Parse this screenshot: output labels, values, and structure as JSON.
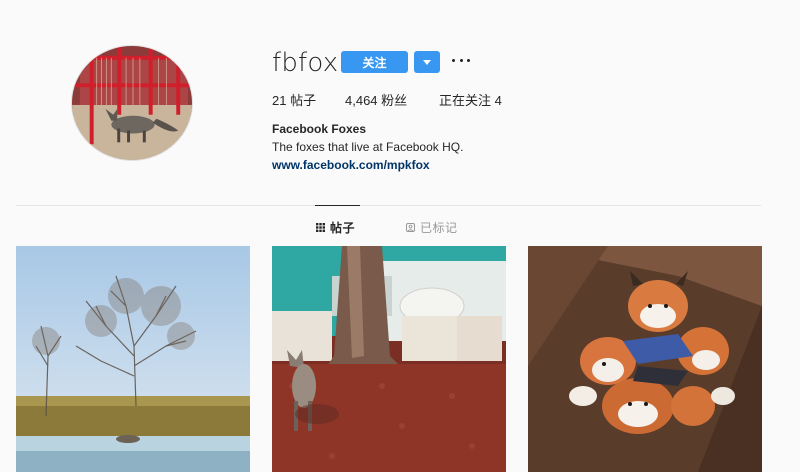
{
  "profile": {
    "username": "fbfox",
    "follow_label": "关注",
    "stats": {
      "posts": "21 帖子",
      "followers": "4,464 粉丝",
      "following": "正在关注 4"
    },
    "bio": {
      "name": "Facebook Foxes",
      "text": "The foxes that live at Facebook HQ.",
      "link": "www.facebook.com/mpkfox"
    }
  },
  "tabs": {
    "posts_label": "帖子",
    "tagged_label": "已标记"
  },
  "icons": {
    "dropdown": "chevron-down-icon",
    "more": "more-options-icon",
    "posts_tab": "grid-icon",
    "tagged_tab": "tag-icon"
  },
  "colors": {
    "accent": "#3897f0",
    "link": "#003569",
    "background": "#fafafa"
  }
}
